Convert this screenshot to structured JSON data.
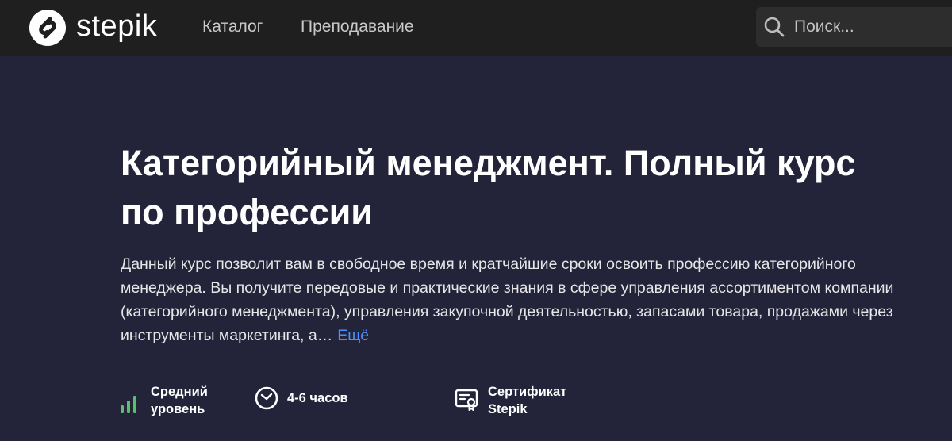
{
  "header": {
    "logo_text": "stepik",
    "nav": {
      "catalog": "Каталог",
      "teaching": "Преподавание"
    },
    "search": {
      "placeholder": "Поиск..."
    }
  },
  "course": {
    "title": "Категорийный менеджмент. Полный курс по профессии",
    "description": "Данный курс позволит вам в свободное время и кратчайшие сроки освоить профессию категорийного менеджера. Вы получите передовые и практические знания в сфере управления ассортиментом компании (категорийного менеджмента), управления закупочной деятельностью, запасами товара, продажами через инструменты маркетинга, а…",
    "more_label": "Ещё"
  },
  "features": {
    "level": {
      "line1": "Средний",
      "line2": "уровень",
      "icon": "signal-bars-icon"
    },
    "duration": {
      "label": "4-6 часов",
      "icon": "clock-icon"
    },
    "certificate": {
      "line1": "Сертификат",
      "line2": "Stepik",
      "icon": "certificate-icon"
    }
  },
  "colors": {
    "header_bg": "#1f1f1f",
    "hero_bg": "#23243a",
    "link": "#4f8ef7",
    "level_accent": "#57c26b"
  }
}
